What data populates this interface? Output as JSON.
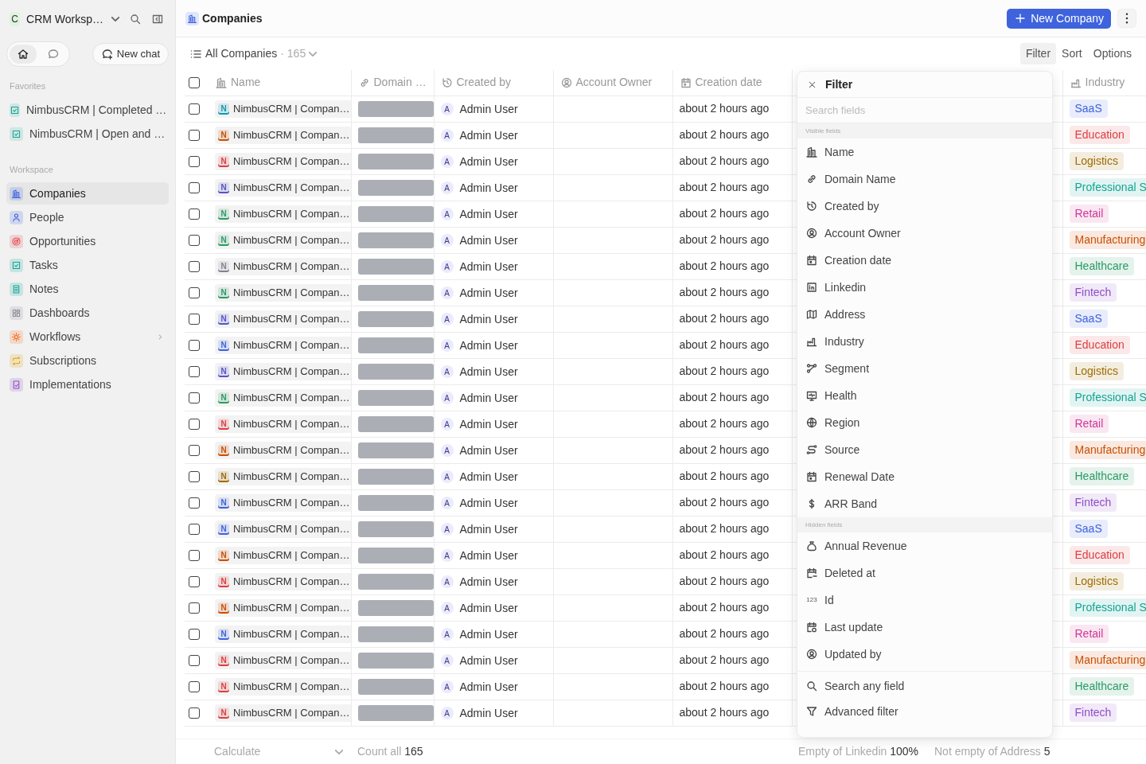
{
  "sidebar": {
    "workspace": {
      "initial": "C",
      "name": "CRM Worksp…"
    },
    "nav_tabs": [
      {
        "selected": true
      },
      {
        "selected": false
      }
    ],
    "new_chat": "New chat",
    "favorites": {
      "title": "Favorites",
      "items": [
        {
          "label": "NimbusCRM | Completed …",
          "color": "#12a594"
        },
        {
          "label": "NimbusCRM | Open and …",
          "color": "#12a594"
        }
      ]
    },
    "workspace_section": {
      "title": "Workspace",
      "items": [
        {
          "label": "Companies",
          "color": "#3e63dd",
          "selected": true,
          "expandable": false
        },
        {
          "label": "People",
          "color": "#3e63dd",
          "selected": false,
          "expandable": false
        },
        {
          "label": "Opportunities",
          "color": "#e5484d",
          "selected": false,
          "expandable": false
        },
        {
          "label": "Tasks",
          "color": "#12a594",
          "selected": false,
          "expandable": false
        },
        {
          "label": "Notes",
          "color": "#12a594",
          "selected": false,
          "expandable": false
        },
        {
          "label": "Dashboards",
          "color": "#8b8d98",
          "selected": false,
          "expandable": false
        },
        {
          "label": "Workflows",
          "color": "#f76b15",
          "selected": false,
          "expandable": true
        },
        {
          "label": "Subscriptions",
          "color": "#e2a300",
          "selected": false,
          "expandable": false
        },
        {
          "label": "Implementations",
          "color": "#8e4ec6",
          "selected": false,
          "expandable": false
        }
      ]
    }
  },
  "header": {
    "title": "Companies",
    "new_button": "New Company"
  },
  "view_bar": {
    "view": "All Companies",
    "count_text": "· 165",
    "actions": [
      {
        "label": "Filter",
        "selected": true
      },
      {
        "label": "Sort",
        "selected": false
      },
      {
        "label": "Options",
        "selected": false
      }
    ]
  },
  "table": {
    "header_checkbox": {
      "checked": false
    },
    "columns": [
      {
        "label": "Name"
      },
      {
        "label": "Domain …"
      },
      {
        "label": "Created by"
      },
      {
        "label": "Account Owner"
      },
      {
        "label": "Creation date"
      },
      {
        "label": "Industry"
      }
    ],
    "rows": [
      {
        "checked": false,
        "avatar": {
          "letter": "N",
          "color": "#0d9ab0"
        },
        "name": "NimbusCRM | Compan…",
        "creator_avatar": "A",
        "created_by": "Admin User",
        "creation_date": "about 2 hours ago",
        "industry": {
          "label": "SaaS",
          "color": "#3e63dd"
        }
      },
      {
        "checked": false,
        "avatar": {
          "letter": "N",
          "color": "#cc4e00"
        },
        "name": "NimbusCRM | Compan…",
        "creator_avatar": "A",
        "created_by": "Admin User",
        "creation_date": "about 2 hours ago",
        "industry": {
          "label": "Education",
          "color": "#dc3e42"
        }
      },
      {
        "checked": false,
        "avatar": {
          "letter": "N",
          "color": "#dc3e42"
        },
        "name": "NimbusCRM | Compan…",
        "creator_avatar": "A",
        "created_by": "Admin User",
        "creation_date": "about 2 hours ago",
        "industry": {
          "label": "Logistics",
          "color": "#9e6c00"
        }
      },
      {
        "checked": false,
        "avatar": {
          "letter": "N",
          "color": "#5753c6"
        },
        "name": "NimbusCRM | Compan…",
        "creator_avatar": "A",
        "created_by": "Admin User",
        "creation_date": "about 2 hours ago",
        "industry": {
          "label": "Professional S",
          "color": "#12a594"
        }
      },
      {
        "checked": false,
        "avatar": {
          "letter": "N",
          "color": "#2b9a66"
        },
        "name": "NimbusCRM | Compan…",
        "creator_avatar": "A",
        "created_by": "Admin User",
        "creation_date": "about 2 hours ago",
        "industry": {
          "label": "Retail",
          "color": "#cf3897"
        }
      },
      {
        "checked": false,
        "avatar": {
          "letter": "N",
          "color": "#2b9a66"
        },
        "name": "NimbusCRM | Compan…",
        "creator_avatar": "A",
        "created_by": "Admin User",
        "creation_date": "about 2 hours ago",
        "industry": {
          "label": "Manufacturing",
          "color": "#cc4e00"
        }
      },
      {
        "checked": false,
        "avatar": {
          "letter": "N",
          "color": "#80838d"
        },
        "name": "NimbusCRM | Compan…",
        "creator_avatar": "A",
        "created_by": "Admin User",
        "creation_date": "about 2 hours ago",
        "industry": {
          "label": "Healthcare",
          "color": "#2b9a66"
        }
      },
      {
        "checked": false,
        "avatar": {
          "letter": "N",
          "color": "#2b9a66"
        },
        "name": "NimbusCRM | Compan…",
        "creator_avatar": "A",
        "created_by": "Admin User",
        "creation_date": "about 2 hours ago",
        "industry": {
          "label": "Fintech",
          "color": "#8e4ec6"
        }
      },
      {
        "checked": false,
        "avatar": {
          "letter": "N",
          "color": "#5753c6"
        },
        "name": "NimbusCRM | Compan…",
        "creator_avatar": "A",
        "created_by": "Admin User",
        "creation_date": "about 2 hours ago",
        "industry": {
          "label": "SaaS",
          "color": "#3e63dd"
        }
      },
      {
        "checked": false,
        "avatar": {
          "letter": "N",
          "color": "#3e63dd"
        },
        "name": "NimbusCRM | Compan…",
        "creator_avatar": "A",
        "created_by": "Admin User",
        "creation_date": "about 2 hours ago",
        "industry": {
          "label": "Education",
          "color": "#dc3e42"
        }
      },
      {
        "checked": false,
        "avatar": {
          "letter": "N",
          "color": "#5753c6"
        },
        "name": "NimbusCRM | Compan…",
        "creator_avatar": "A",
        "created_by": "Admin User",
        "creation_date": "about 2 hours ago",
        "industry": {
          "label": "Logistics",
          "color": "#9e6c00"
        }
      },
      {
        "checked": false,
        "avatar": {
          "letter": "N",
          "color": "#2b9a66"
        },
        "name": "NimbusCRM | Compan…",
        "creator_avatar": "A",
        "created_by": "Admin User",
        "creation_date": "about 2 hours ago",
        "industry": {
          "label": "Professional S",
          "color": "#12a594"
        }
      },
      {
        "checked": false,
        "avatar": {
          "letter": "N",
          "color": "#dc3e42"
        },
        "name": "NimbusCRM | Compan…",
        "creator_avatar": "A",
        "created_by": "Admin User",
        "creation_date": "about 2 hours ago",
        "industry": {
          "label": "Retail",
          "color": "#cf3897"
        }
      },
      {
        "checked": false,
        "avatar": {
          "letter": "N",
          "color": "#cc4e00"
        },
        "name": "NimbusCRM | Compan…",
        "creator_avatar": "A",
        "created_by": "Admin User",
        "creation_date": "about 2 hours ago",
        "industry": {
          "label": "Manufacturing",
          "color": "#cc4e00"
        }
      },
      {
        "checked": false,
        "avatar": {
          "letter": "N",
          "color": "#9e6c00"
        },
        "name": "NimbusCRM | Compan…",
        "creator_avatar": "A",
        "created_by": "Admin User",
        "creation_date": "about 2 hours ago",
        "industry": {
          "label": "Healthcare",
          "color": "#2b9a66"
        }
      },
      {
        "checked": false,
        "avatar": {
          "letter": "N",
          "color": "#3e63dd"
        },
        "name": "NimbusCRM | Compan…",
        "creator_avatar": "A",
        "created_by": "Admin User",
        "creation_date": "about 2 hours ago",
        "industry": {
          "label": "Fintech",
          "color": "#8e4ec6"
        }
      },
      {
        "checked": false,
        "avatar": {
          "letter": "N",
          "color": "#3e63dd"
        },
        "name": "NimbusCRM | Compan…",
        "creator_avatar": "A",
        "created_by": "Admin User",
        "creation_date": "about 2 hours ago",
        "industry": {
          "label": "SaaS",
          "color": "#3e63dd"
        }
      },
      {
        "checked": false,
        "avatar": {
          "letter": "N",
          "color": "#cc4e00"
        },
        "name": "NimbusCRM | Compan…",
        "creator_avatar": "A",
        "created_by": "Admin User",
        "creation_date": "about 2 hours ago",
        "industry": {
          "label": "Education",
          "color": "#dc3e42"
        }
      },
      {
        "checked": false,
        "avatar": {
          "letter": "N",
          "color": "#dc3e42"
        },
        "name": "NimbusCRM | Compan…",
        "creator_avatar": "A",
        "created_by": "Admin User",
        "creation_date": "about 2 hours ago",
        "industry": {
          "label": "Logistics",
          "color": "#9e6c00"
        }
      },
      {
        "checked": false,
        "avatar": {
          "letter": "N",
          "color": "#cc4e00"
        },
        "name": "NimbusCRM | Compan…",
        "creator_avatar": "A",
        "created_by": "Admin User",
        "creation_date": "about 2 hours ago",
        "industry": {
          "label": "Professional S",
          "color": "#12a594"
        }
      },
      {
        "checked": false,
        "avatar": {
          "letter": "N",
          "color": "#3e63dd"
        },
        "name": "NimbusCRM | Compan…",
        "creator_avatar": "A",
        "created_by": "Admin User",
        "creation_date": "about 2 hours ago",
        "industry": {
          "label": "Retail",
          "color": "#cf3897"
        }
      },
      {
        "checked": false,
        "avatar": {
          "letter": "N",
          "color": "#dc3e42"
        },
        "name": "NimbusCRM | Compan…",
        "creator_avatar": "A",
        "created_by": "Admin User",
        "creation_date": "about 2 hours ago",
        "industry": {
          "label": "Manufacturing",
          "color": "#cc4e00"
        }
      },
      {
        "checked": false,
        "avatar": {
          "letter": "N",
          "color": "#dc3e42"
        },
        "name": "NimbusCRM | Compan…",
        "creator_avatar": "A",
        "created_by": "Admin User",
        "creation_date": "about 2 hours ago",
        "industry": {
          "label": "Healthcare",
          "color": "#2b9a66"
        }
      },
      {
        "checked": false,
        "avatar": {
          "letter": "N",
          "color": "#dc3e42"
        },
        "name": "NimbusCRM | Compan…",
        "creator_avatar": "A",
        "created_by": "Admin User",
        "creation_date": "about 2 hours ago",
        "industry": {
          "label": "Fintech",
          "color": "#8e4ec6"
        }
      }
    ]
  },
  "filter_panel": {
    "title": "Filter",
    "placeholder": "Search fields",
    "sections": [
      {
        "title": "Visible fields",
        "items": [
          {
            "label": "Name"
          },
          {
            "label": "Domain Name"
          },
          {
            "label": "Created by"
          },
          {
            "label": "Account Owner"
          },
          {
            "label": "Creation date"
          },
          {
            "label": "Linkedin"
          },
          {
            "label": "Address"
          },
          {
            "label": "Industry"
          },
          {
            "label": "Segment"
          },
          {
            "label": "Health"
          },
          {
            "label": "Region"
          },
          {
            "label": "Source"
          },
          {
            "label": "Renewal Date"
          },
          {
            "label": "ARR Band"
          }
        ]
      },
      {
        "title": "Hidden fields",
        "items": [
          {
            "label": "Annual Revenue"
          },
          {
            "label": "Deleted at"
          },
          {
            "label": "Id",
            "glyph": "123"
          },
          {
            "label": "Last update"
          },
          {
            "label": "Updated by"
          }
        ]
      }
    ],
    "actions": [
      "Search any field",
      "Advanced filter"
    ]
  },
  "footer": {
    "calculate": "Calculate",
    "aggregates": [
      "Count all **165**",
      "Empty of Linkedin **100%**",
      "Not empty of Address **5**"
    ]
  }
}
